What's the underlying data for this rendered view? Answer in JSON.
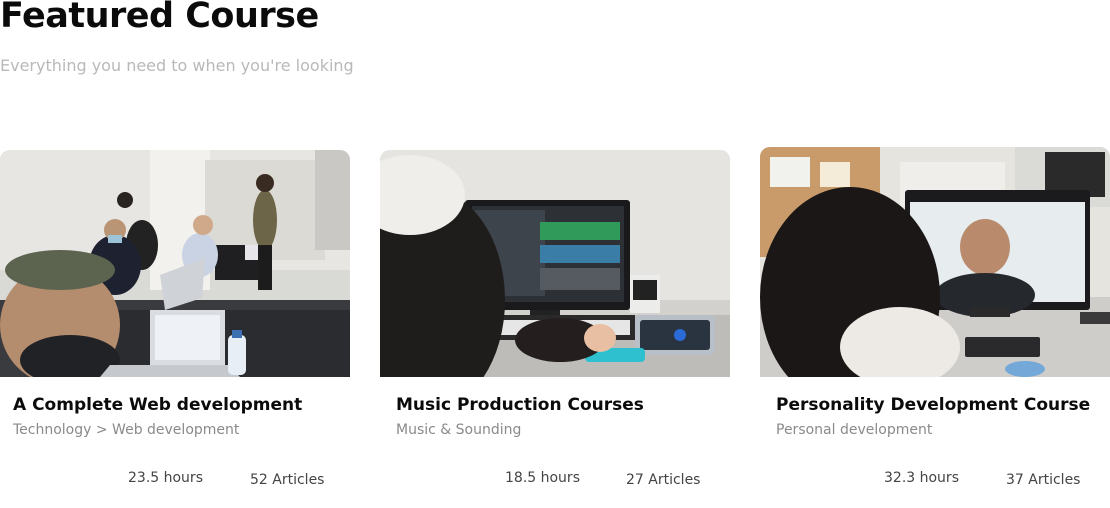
{
  "header": {
    "title": "Featured Course",
    "subtitle": "Everything you need to  when you're looking"
  },
  "courses": [
    {
      "title": "A Complete Web development",
      "category": "Technology > Web development",
      "hours": "23.5 hours",
      "articles": "52 Articles",
      "image": "classroom-laptops-photo"
    },
    {
      "title": "Music Production Courses",
      "category": "Music & Sounding",
      "hours": "18.5 hours",
      "articles": "27 Articles",
      "image": "music-studio-monitor-photo"
    },
    {
      "title": "Personality Development Course",
      "category": "Personal development",
      "hours": "32.3 hours",
      "articles": "37 Articles",
      "image": "video-call-monitor-photo"
    }
  ]
}
